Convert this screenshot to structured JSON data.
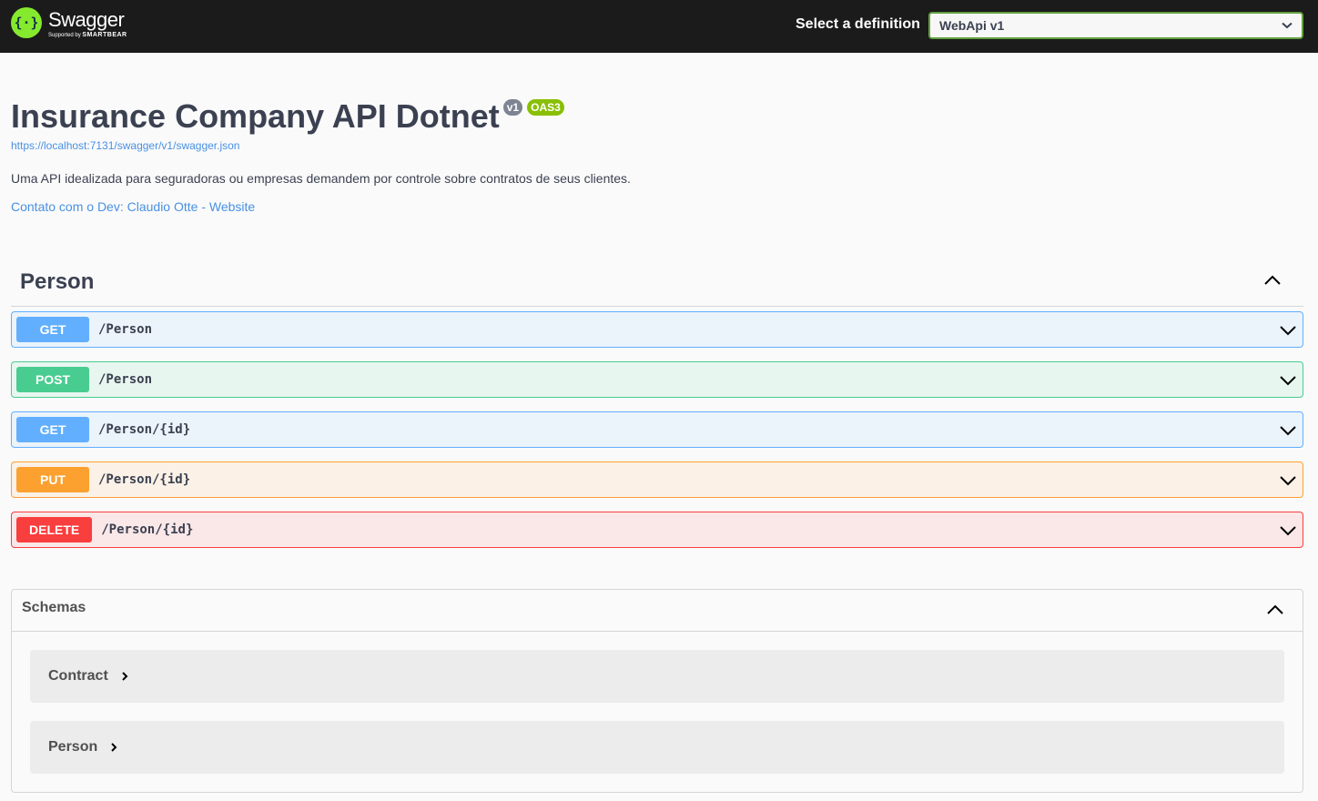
{
  "topbar": {
    "logo": {
      "name": "Swagger",
      "supported_prefix": "Supported by",
      "supported_brand": "SMARTBEAR",
      "icon": "swagger-braces-icon"
    },
    "definition_label": "Select a definition",
    "definition_value": "WebApi v1"
  },
  "info": {
    "title": "Insurance Company API Dotnet",
    "version_badge": "v1",
    "oas_badge": "OAS3",
    "spec_url": "https://localhost:7131/swagger/v1/swagger.json",
    "description": "Uma API idealizada para seguradoras ou empresas demandem por controle sobre contratos de seus clientes.",
    "contact": "Contato com o Dev: Claudio Otte - Website"
  },
  "tag": {
    "name": "Person",
    "toggle_icon": "chevron-up-icon"
  },
  "operations": [
    {
      "method": "GET",
      "path": "/Person"
    },
    {
      "method": "POST",
      "path": "/Person"
    },
    {
      "method": "GET",
      "path": "/Person/{id}"
    },
    {
      "method": "PUT",
      "path": "/Person/{id}"
    },
    {
      "method": "DELETE",
      "path": "/Person/{id}"
    }
  ],
  "schemas": {
    "title": "Schemas",
    "models": [
      {
        "name": "Contract"
      },
      {
        "name": "Person"
      }
    ]
  },
  "colors": {
    "topbar": "#1b1b1b",
    "logo_green": "#85ea2d",
    "get": "#61affe",
    "post": "#49cc90",
    "put": "#fca130",
    "delete": "#f93e3e",
    "link": "#4990e2"
  }
}
